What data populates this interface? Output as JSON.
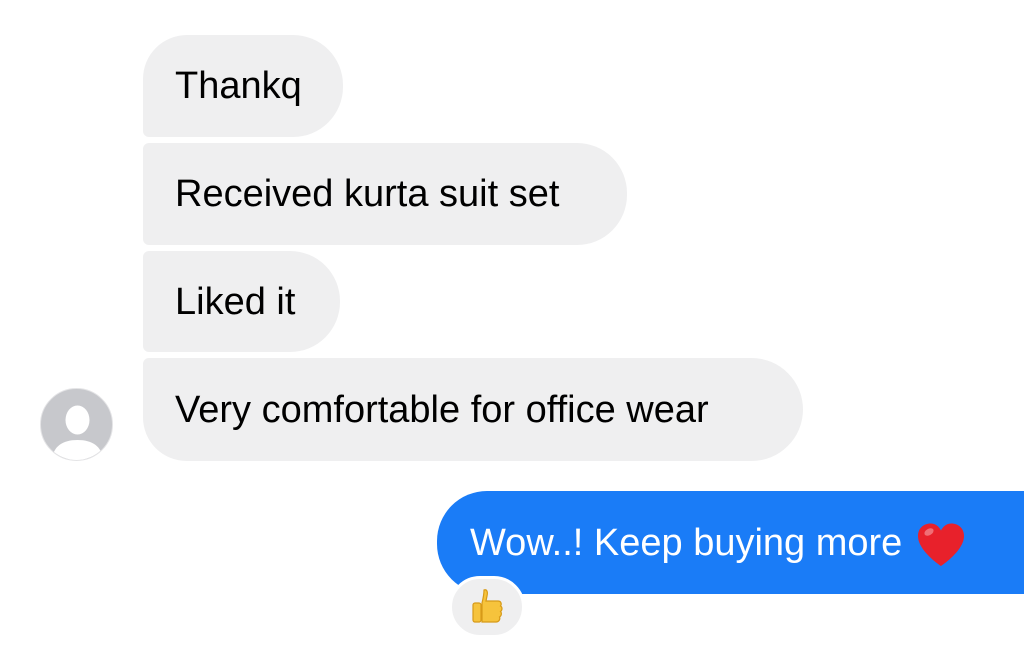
{
  "conversation": {
    "incoming_messages": [
      {
        "text": "Thankq"
      },
      {
        "text": "Received kurta suit set"
      },
      {
        "text": "Liked it"
      },
      {
        "text": "Very comfortable for office wear"
      }
    ],
    "outgoing_message": {
      "text": "Wow..! Keep buying more",
      "emoji_icon": "red-heart-icon"
    },
    "reaction": {
      "icon": "thumbs-up-icon"
    },
    "sender_avatar": {
      "icon": "default-person-silhouette-icon"
    }
  },
  "colors": {
    "incoming_bubble": "#efeff0",
    "outgoing_bubble": "#1a7cf7",
    "avatar_background": "#c7c8cc",
    "heart": "#e8212b"
  }
}
